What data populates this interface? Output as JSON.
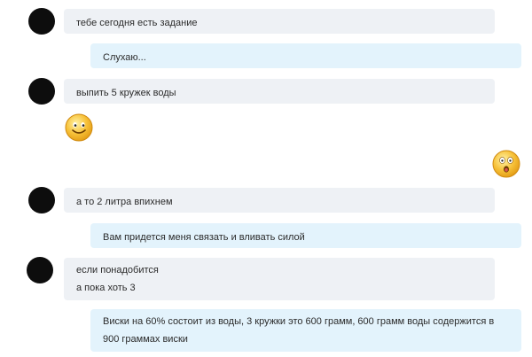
{
  "chat": {
    "messages": [
      {
        "direction": "incoming",
        "text": "тебе сегодня есть задание"
      },
      {
        "direction": "outgoing",
        "text": "Слухаю..."
      },
      {
        "direction": "incoming",
        "text": "выпить 5 кружек воды"
      },
      {
        "direction": "incoming",
        "emoji": "smile-emoticon"
      },
      {
        "direction": "outgoing",
        "emoji": "surprised-emoticon"
      },
      {
        "direction": "incoming",
        "text": "а то 2 литра впихнем"
      },
      {
        "direction": "outgoing",
        "text": "Вам придется меня связать и вливать силой"
      },
      {
        "direction": "incoming",
        "lines": [
          "если понадобится",
          "а пока хоть 3"
        ]
      },
      {
        "direction": "outgoing",
        "lines": [
          "Виски на 60% состоит из воды, 3 кружки это 600 грамм, 600 грамм воды содержится в",
          "900 граммах виски"
        ]
      }
    ]
  },
  "colors": {
    "incoming_bubble": "#eef1f5",
    "outgoing_bubble": "#e3f3fc",
    "text": "#2b2b2b",
    "emoji_yellow": "#f7c23a"
  }
}
